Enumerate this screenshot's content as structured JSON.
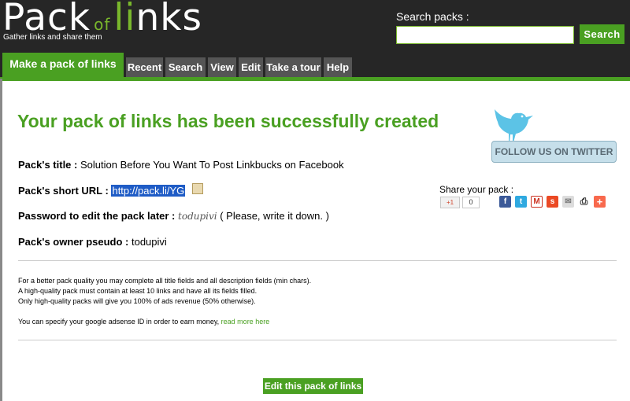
{
  "header": {
    "logo": {
      "part1": "Pack",
      "part2": "of",
      "part3": "li",
      "part4": "nks"
    },
    "tagline": "Gather links and share them",
    "search_label": "Search packs :",
    "search_placeholder": "",
    "search_button": "Search"
  },
  "nav": {
    "tabs": [
      {
        "label": "Make a pack of links",
        "active": true
      },
      {
        "label": "Recent"
      },
      {
        "label": "Search"
      },
      {
        "label": "View"
      },
      {
        "label": "Edit"
      },
      {
        "label": "Take a tour"
      },
      {
        "label": "Help"
      }
    ]
  },
  "main": {
    "headline": "Your pack of links has been successfully created",
    "follow_button": "FOLLOW US ON TWITTER",
    "pack_title_label": "Pack's title :",
    "pack_title_value": "Solution Before You Want To Post Linkbucks on Facebook",
    "short_url_label": "Pack's short URL :",
    "short_url_value": "http://pack.li/YG",
    "password_label": "Password to edit the pack later :",
    "password_value": "todupivi",
    "password_note": "( Please, write it down. )",
    "owner_label": "Pack's owner pseudo :",
    "owner_value": "todupivi",
    "share_label": "Share your pack :",
    "gplus_label": "+1",
    "gplus_count": "0",
    "share_icons": [
      "facebook-icon",
      "twitter-icon",
      "gmail-icon",
      "stumbleupon-icon",
      "email-icon",
      "print-icon",
      "addthis-icon"
    ],
    "notes": {
      "line1": "For a better pack quality you may complete all title fields and all description fields (min chars).",
      "line2": "A high-quality pack must contain at least 10 links and have all its fields filled.",
      "line3": "Only high-quality packs will give you 100% of ads revenue (50% otherwise).",
      "line4": "You can specify your google adsense ID in order to earn money,",
      "read_more": "read more here"
    },
    "edit_button": "Edit this pack of links"
  },
  "colors": {
    "brand_green": "#4aa022",
    "header_bg": "#262626",
    "tab_bg": "#555555",
    "twitter_blue": "#5cc3e6"
  }
}
